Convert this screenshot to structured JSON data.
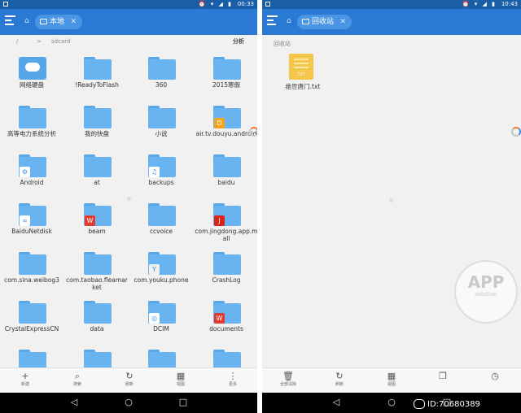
{
  "left_screen": {
    "status": {
      "time": "00:33"
    },
    "location_chip": "本地",
    "breadcrumb": {
      "root": "/",
      "sep": ">",
      "current": "sdcard"
    },
    "analyze_label": "分析",
    "items": [
      {
        "label": "网络硬盘",
        "icon": "cloud-drive-icon",
        "badge": ""
      },
      {
        "label": "!ReadyToFlash",
        "icon": "folder-icon",
        "badge": ""
      },
      {
        "label": "360",
        "icon": "folder-icon",
        "badge": ""
      },
      {
        "label": "2015寒假",
        "icon": "folder-icon",
        "badge": ""
      },
      {
        "label": "高等电力系统分析",
        "icon": "folder-icon",
        "badge": ""
      },
      {
        "label": "我的快盘",
        "icon": "folder-icon",
        "badge": ""
      },
      {
        "label": "小说",
        "icon": "folder-icon",
        "badge": ""
      },
      {
        "label": "air.tv.douyu.android",
        "icon": "folder-app-icon",
        "badge": "D"
      },
      {
        "label": "Android",
        "icon": "folder-settings-icon",
        "badge": "⚙"
      },
      {
        "label": "at",
        "icon": "folder-icon",
        "badge": ""
      },
      {
        "label": "backups",
        "icon": "folder-backup-icon",
        "badge": "♫"
      },
      {
        "label": "baidu",
        "icon": "folder-icon",
        "badge": ""
      },
      {
        "label": "BaiduNetdisk",
        "icon": "folder-app-icon",
        "badge": "∞"
      },
      {
        "label": "beam",
        "icon": "folder-app-icon",
        "badge": "W"
      },
      {
        "label": "ccvoice",
        "icon": "folder-icon",
        "badge": ""
      },
      {
        "label": "com.jingdong.app.mall",
        "icon": "folder-app-icon",
        "badge": "J"
      },
      {
        "label": "com.sina.weibog3",
        "icon": "folder-icon",
        "badge": ""
      },
      {
        "label": "com.taobao.fleamarket",
        "icon": "folder-icon",
        "badge": ""
      },
      {
        "label": "com.youku.phone",
        "icon": "folder-app-icon",
        "badge": "Y"
      },
      {
        "label": "CrashLog",
        "icon": "folder-icon",
        "badge": ""
      },
      {
        "label": "CrystalExpressCN",
        "icon": "folder-icon",
        "badge": ""
      },
      {
        "label": "data",
        "icon": "folder-icon",
        "badge": ""
      },
      {
        "label": "DCIM",
        "icon": "folder-camera-icon",
        "badge": "◎"
      },
      {
        "label": "documents",
        "icon": "folder-app-icon",
        "badge": "W"
      },
      {
        "label": "",
        "icon": "folder-icon",
        "badge": ""
      },
      {
        "label": "",
        "icon": "folder-icon",
        "badge": ""
      },
      {
        "label": "",
        "icon": "folder-icon",
        "badge": ""
      },
      {
        "label": "",
        "icon": "folder-icon",
        "badge": ""
      }
    ],
    "toolbar": [
      {
        "label": "新建",
        "icon": "plus-icon",
        "glyph": "+"
      },
      {
        "label": "搜索",
        "icon": "search-icon",
        "glyph": "⌕"
      },
      {
        "label": "刷新",
        "icon": "refresh-icon",
        "glyph": "↻"
      },
      {
        "label": "视图",
        "icon": "grid-view-icon",
        "glyph": "▦"
      },
      {
        "label": "更多",
        "icon": "more-icon",
        "glyph": "⋮"
      }
    ]
  },
  "right_screen": {
    "status": {
      "time": "10:43"
    },
    "location_chip": "回收站",
    "section_label": "回收站",
    "file": {
      "label": "绝世唐门.txt",
      "type_label": "TXT"
    },
    "toolbar": [
      {
        "label": "全部清除",
        "icon": "trash-icon",
        "glyph": "🗑"
      },
      {
        "label": "刷新",
        "icon": "refresh-icon",
        "glyph": "↻"
      },
      {
        "label": "视图",
        "icon": "grid-view-icon",
        "glyph": "▦"
      },
      {
        "label": "",
        "icon": "window-icon",
        "glyph": "❐"
      },
      {
        "label": "",
        "icon": "history-icon",
        "glyph": "◷"
      }
    ],
    "watermark": {
      "line1": "APP",
      "line2": "solution"
    },
    "wechat_caption": "ID:70680389"
  },
  "nav": {
    "back": "◁",
    "home": "○",
    "recents": "□"
  },
  "colors": {
    "appbar": "#2a7ad3",
    "statusbar": "#1b5ea8",
    "folder": "#69b3f0"
  }
}
